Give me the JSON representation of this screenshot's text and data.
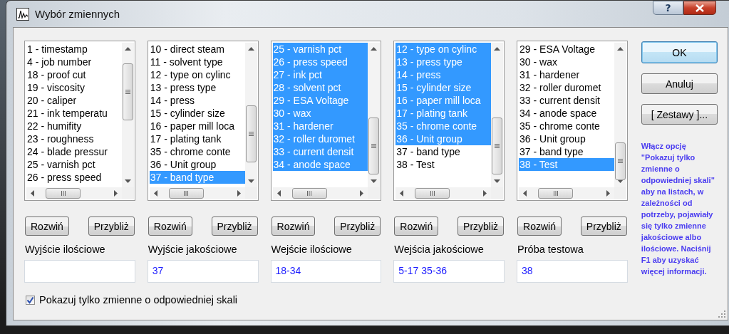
{
  "window": {
    "title": "Wybór zmiennych",
    "help_button": "?"
  },
  "lists": [
    {
      "items": [
        {
          "label": "1 - timestamp",
          "selected": false
        },
        {
          "label": "4 - job number",
          "selected": false
        },
        {
          "label": "18 - proof cut",
          "selected": false
        },
        {
          "label": "19 - viscosity",
          "selected": false
        },
        {
          "label": "20 - caliper",
          "selected": false
        },
        {
          "label": "21 - ink temperatu",
          "selected": false
        },
        {
          "label": "22 - humifity",
          "selected": false
        },
        {
          "label": "23 - roughness",
          "selected": false
        },
        {
          "label": "24 - blade pressur",
          "selected": false
        },
        {
          "label": "25 - varnish pct",
          "selected": false
        },
        {
          "label": "26 - press speed",
          "selected": false
        }
      ],
      "expand_button": "Rozwiń",
      "zoom_button": "Przybliż",
      "field_label": "Wyjście ilościowe"
    },
    {
      "items": [
        {
          "label": "10 - direct steam",
          "selected": false
        },
        {
          "label": "11 - solvent type",
          "selected": false
        },
        {
          "label": "12 - type on cylinc",
          "selected": false
        },
        {
          "label": "13 - press type",
          "selected": false
        },
        {
          "label": "14 - press",
          "selected": false
        },
        {
          "label": "15 - cylinder size",
          "selected": false
        },
        {
          "label": "16 - paper mill loca",
          "selected": false
        },
        {
          "label": "17 - plating tank",
          "selected": false
        },
        {
          "label": "35 - chrome conte",
          "selected": false
        },
        {
          "label": "36 - Unit group",
          "selected": false
        },
        {
          "label": "37 - band type",
          "selected": true
        }
      ],
      "expand_button": "Rozwiń",
      "zoom_button": "Przybliż",
      "field_label": "Wyjście jakościowe",
      "field_value": "37"
    },
    {
      "items": [
        {
          "label": "25 - varnish pct",
          "selected": true
        },
        {
          "label": "26 - press speed",
          "selected": true
        },
        {
          "label": "27 - ink pct",
          "selected": true
        },
        {
          "label": "28 - solvent pct",
          "selected": true
        },
        {
          "label": "29 - ESA Voltage",
          "selected": true
        },
        {
          "label": "30 - wax",
          "selected": true
        },
        {
          "label": "31 - hardener",
          "selected": true
        },
        {
          "label": "32 - roller duromet",
          "selected": true
        },
        {
          "label": "33 - current densit",
          "selected": true
        },
        {
          "label": "34 - anode space",
          "selected": true
        }
      ],
      "expand_button": "Rozwiń",
      "zoom_button": "Przybliż",
      "field_label": "Wejście ilościowe",
      "field_value": "18-34"
    },
    {
      "items": [
        {
          "label": "12 - type on cylinc",
          "selected": true
        },
        {
          "label": "13 - press type",
          "selected": true
        },
        {
          "label": "14 - press",
          "selected": true
        },
        {
          "label": "15 - cylinder size",
          "selected": true
        },
        {
          "label": "16 - paper mill loca",
          "selected": true
        },
        {
          "label": "17 - plating tank",
          "selected": true
        },
        {
          "label": "35 - chrome conte",
          "selected": true
        },
        {
          "label": "36 - Unit group",
          "selected": true
        },
        {
          "label": "37 - band type",
          "selected": false
        },
        {
          "label": "38 - Test",
          "selected": false
        }
      ],
      "expand_button": "Rozwiń",
      "zoom_button": "Przybliż",
      "field_label": "Wejścia jakościowe",
      "field_value": "5-17 35-36"
    },
    {
      "items": [
        {
          "label": "29 - ESA Voltage",
          "selected": false
        },
        {
          "label": "30 - wax",
          "selected": false
        },
        {
          "label": "31 - hardener",
          "selected": false
        },
        {
          "label": "32 - roller duromet",
          "selected": false
        },
        {
          "label": "33 - current densit",
          "selected": false
        },
        {
          "label": "34 - anode space",
          "selected": false
        },
        {
          "label": "35 - chrome conte",
          "selected": false
        },
        {
          "label": "36 - Unit group",
          "selected": false
        },
        {
          "label": "37 - band type",
          "selected": false
        },
        {
          "label": "38 - Test",
          "selected": true
        }
      ],
      "expand_button": "Rozwiń",
      "zoom_button": "Przybliż",
      "field_label": "Próba testowa",
      "field_value": "38"
    }
  ],
  "buttons": [
    "OK",
    "Anuluj",
    "[ Zestawy ]..."
  ],
  "help_text": "Włącz opcję \"Pokazuj tylko zmienne o odpowiedniej skali\" aby na listach, w zależności od potrzeby, pojawiały się tylko zmienne jakościowe albo ilościowe. Naciśnij F1 aby uzyskać więcej informacji.",
  "checkbox": {
    "label": "Pokazuj tylko zmienne o odpowiedniej skali",
    "checked": true
  }
}
